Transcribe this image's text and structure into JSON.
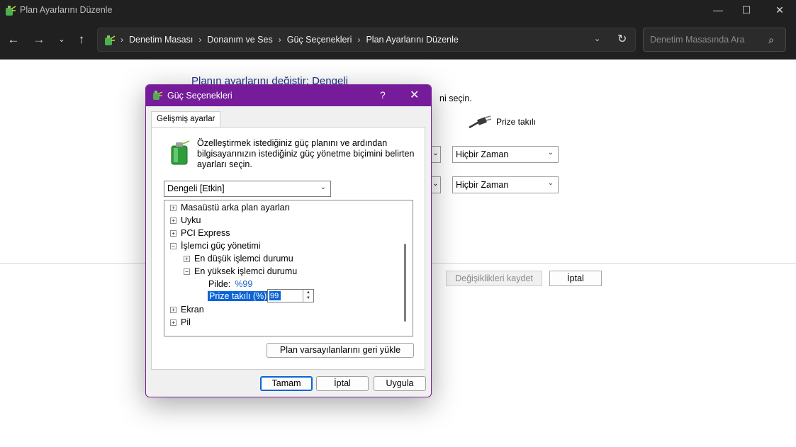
{
  "window": {
    "title": "Plan Ayarlarını Düzenle",
    "controls": {
      "minimize": "—",
      "maximize": "☐",
      "close": "✕"
    }
  },
  "nav": {
    "back": "←",
    "forward": "→",
    "recent": "⌄",
    "up": "↑",
    "breadcrumb": [
      "Denetim Masası",
      "Donanım ve Ses",
      "Güç Seçenekleri",
      "Plan Ayarlarını Düzenle"
    ],
    "separator": "›",
    "dropdown": "⌄",
    "refresh": "↻",
    "search_placeholder": "Denetim Masasında Ara",
    "search_icon": "⌕"
  },
  "background": {
    "heading": "Planın ayarlarını değiştir: Dengeli",
    "subtext": "ni seçin.",
    "plugged_in_label": "Prize takılı",
    "select_1": "Hiçbir Zaman",
    "select_2": "Hiçbir Zaman",
    "save_button": "Değişiklikleri kaydet",
    "cancel_button": "İptal"
  },
  "dialog": {
    "title": "Güç Seçenekleri",
    "help": "?",
    "close": "✕",
    "tab": "Gelişmiş ayarlar",
    "description": "Özelleştirmek istediğiniz güç planını ve ardından bilgisayarınızın istediğiniz güç yönetme biçimini belirten ayarları seçin.",
    "plan_select": "Dengeli [Etkin]",
    "tree": {
      "items": [
        {
          "label": "Masaüstü arka plan ayarları",
          "expander": "+"
        },
        {
          "label": "Uyku",
          "expander": "+"
        },
        {
          "label": "PCI Express",
          "expander": "+"
        },
        {
          "label": "İşlemci güç yönetimi",
          "expander": "−"
        },
        {
          "label": "En düşük işlemci durumu",
          "expander": "+"
        },
        {
          "label": "En yüksek işlemci durumu",
          "expander": "−"
        },
        {
          "label": "Ekran",
          "expander": "+"
        },
        {
          "label": "Pil",
          "expander": "+"
        }
      ],
      "battery_label": "Pilde:",
      "battery_value": "%99",
      "plugged_label": "Prize takılı (%):",
      "plugged_value": "99"
    },
    "restore_button": "Plan varsayılanlarını geri yükle",
    "ok_button": "Tamam",
    "cancel_button": "İptal",
    "apply_button": "Uygula"
  },
  "colors": {
    "dialog_accent": "#761b9a",
    "selection": "#0a64d6",
    "link": "#1a5fc6",
    "heading_blue": "#1e3287"
  }
}
